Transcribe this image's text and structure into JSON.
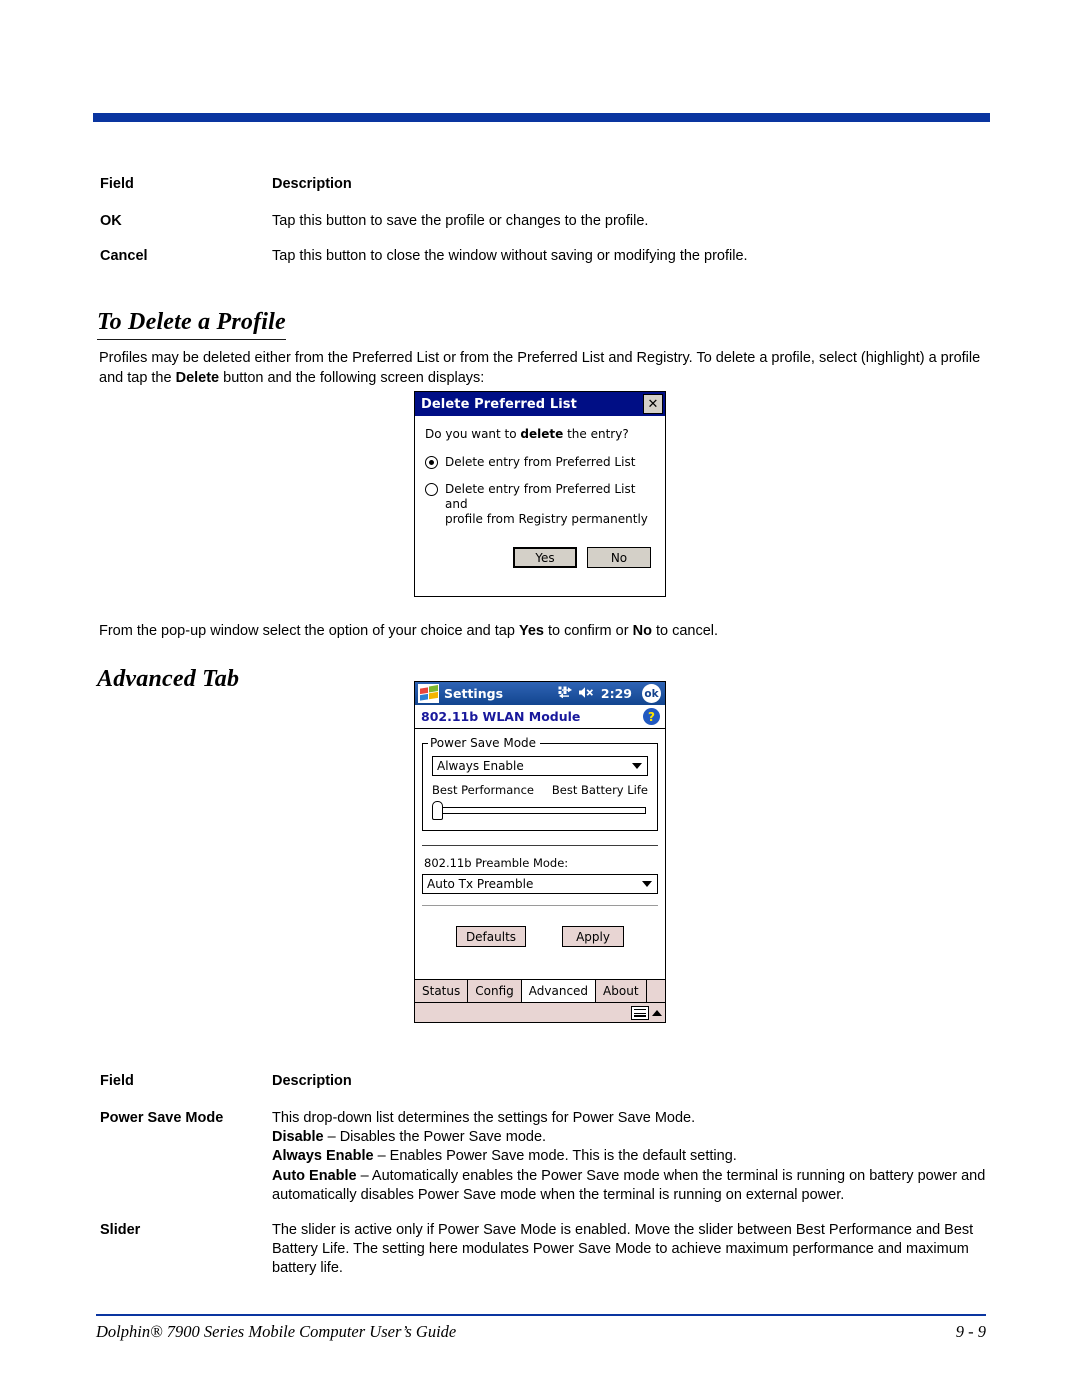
{
  "document": {
    "footer_left": "Dolphin® 7900 Series Mobile Computer User’s Guide",
    "footer_page": "9 - 9"
  },
  "top_table": {
    "header": {
      "field": "Field",
      "description": "Description"
    },
    "rows": [
      {
        "field": "OK",
        "description": "Tap this button to save the profile or changes to the profile."
      },
      {
        "field": "Cancel",
        "description": "Tap this button to close the window without saving or modifying the profile."
      }
    ]
  },
  "delete_section": {
    "heading": "To Delete a Profile",
    "paragraph_part1": "Profiles may be deleted either from the Preferred List or from the Preferred List and Registry. To delete a profile, select (highlight) a profile and tap the ",
    "paragraph_bold": "Delete",
    "paragraph_part2": " button and the following screen displays:"
  },
  "delete_dialog": {
    "title": "Delete Preferred List",
    "close_icon": "✕",
    "prompt_prefix": "Do you want to ",
    "prompt_bold": "delete",
    "prompt_suffix": " the entry?",
    "option1": "Delete entry from Preferred List",
    "option2_line1": "Delete entry from Preferred List and",
    "option2_line2": "profile from Registry permanently",
    "selected_option": 1,
    "yes_label": "Yes",
    "no_label": "No"
  },
  "popup_para": {
    "part1": "From the pop-up window select the option of your choice and tap ",
    "bold1": "Yes",
    "part2": " to confirm or ",
    "bold2": "No",
    "part3": " to cancel."
  },
  "advanced_section": {
    "heading": "Advanced Tab"
  },
  "pda_screen": {
    "status_bar": {
      "app_name": "Settings",
      "clock": "2:29",
      "ok_label": "ok",
      "connectivity_icon": "connectivity-icon",
      "volume_icon": "volume-muted-icon",
      "start_icon": "windows-start-icon"
    },
    "page_bar": {
      "title": "802.11b WLAN Module",
      "help_label": "?"
    },
    "power_save_group": {
      "legend": "Power Save Mode",
      "combo_value": "Always Enable",
      "slider_left_label": "Best Performance",
      "slider_right_label": "Best Battery Life",
      "slider_position_percent": 0
    },
    "preamble": {
      "label": "802.11b Preamble Mode:",
      "combo_value": "Auto Tx Preamble"
    },
    "buttons": {
      "defaults": "Defaults",
      "apply": "Apply"
    },
    "tabs": [
      {
        "label": "Status",
        "active": false
      },
      {
        "label": "Config",
        "active": false
      },
      {
        "label": "Advanced",
        "active": true
      },
      {
        "label": "About",
        "active": false
      }
    ],
    "taskbar": {
      "keyboard_icon": "keyboard-icon",
      "caret_icon": "up-caret-icon"
    }
  },
  "bottom_table": {
    "header": {
      "field": "Field",
      "description": "Description"
    },
    "rows": [
      {
        "field": "Power Save Mode",
        "lines": [
          {
            "bold": "",
            "text": "This drop-down list determines the settings for Power Save Mode."
          },
          {
            "bold": "Disable",
            "text": " – Disables the Power Save mode."
          },
          {
            "bold": "Always Enable",
            "text": " – Enables Power Save mode. This is the default setting."
          },
          {
            "bold": "Auto Enable",
            "text": " – Automatically enables the Power Save mode when the terminal is running on battery power and automatically disables Power Save mode when the terminal is running on external power."
          }
        ]
      },
      {
        "field": "Slider",
        "lines": [
          {
            "bold": "",
            "text": "The slider is active only if Power Save Mode is enabled. Move the slider between Best Performance and Best Battery Life. The setting here modulates Power Save Mode to achieve maximum performance and maximum battery life."
          }
        ]
      }
    ]
  },
  "colors": {
    "rule_blue": "#0a35a0",
    "dialog_titlebar": "#000e85",
    "pda_statusbar": "#1b4f9c",
    "pda_page_title": "#18189c",
    "button_face": "#e8d5d3"
  }
}
